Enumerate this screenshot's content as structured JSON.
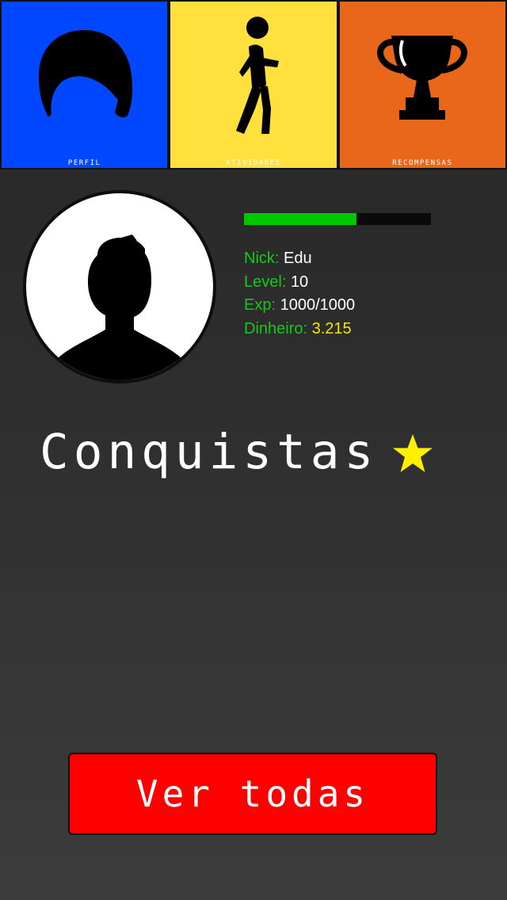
{
  "tabs": [
    {
      "label": "PERFIL",
      "icon": "hair-icon",
      "color": "#0047ff"
    },
    {
      "label": "ATIVIDADES",
      "icon": "walking-person-icon",
      "color": "#ffe03c"
    },
    {
      "label": "RECOMPENSAS",
      "icon": "trophy-icon",
      "color": "#e8671b"
    }
  ],
  "profile": {
    "xp_progress": 0.6,
    "nick_label": "Nick:",
    "nick_value": "Edu",
    "level_label": "Level:",
    "level_value": "10",
    "exp_label": "Exp:",
    "exp_value": "1000/1000",
    "money_label": "Dinheiro:",
    "money_value": "3.215",
    "label_color": "#19c719",
    "money_color": "#f2e600"
  },
  "achievements": {
    "title": "Conquistas",
    "icon": "star-icon",
    "star_color": "#ffef00"
  },
  "view_all": {
    "label": "Ver todas",
    "color": "#ff0000"
  }
}
